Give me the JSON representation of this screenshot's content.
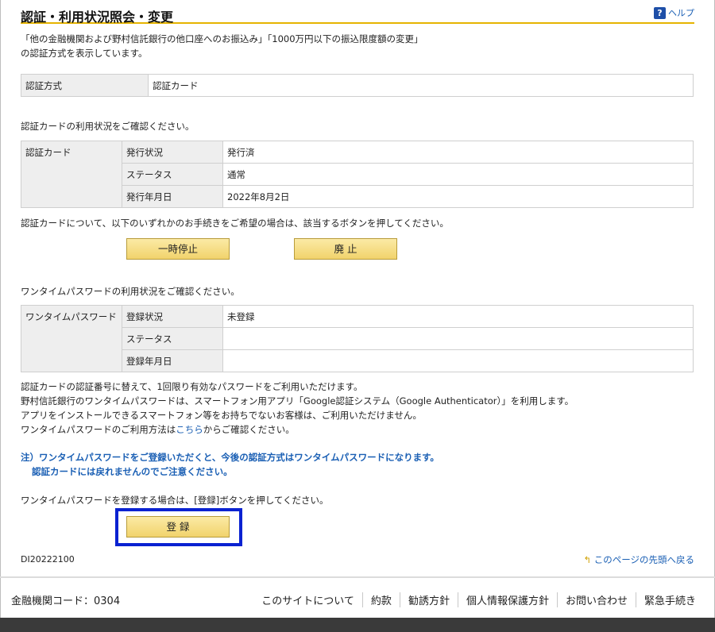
{
  "page": {
    "title": "認証・利用状況照会・変更",
    "help_label": "ヘルプ",
    "help_icon": "question-icon",
    "intro_line1": "「他の金融機関および野村信託銀行の他口座へのお振込み」「1000万円以下の振込限度額の変更」",
    "intro_line2": "の認証方式を表示しています。"
  },
  "auth_method": {
    "label": "認証方式",
    "value": "認証カード"
  },
  "card": {
    "intro": "認証カードの利用状況をご確認ください。",
    "header": "認証カード",
    "rows": [
      {
        "label": "発行状況",
        "value": "発行済"
      },
      {
        "label": "ステータス",
        "value": "通常"
      },
      {
        "label": "発行年月日",
        "value": "2022年8月2日"
      }
    ],
    "instruction": "認証カードについて、以下のいずれかのお手続きをご希望の場合は、該当するボタンを押してください。",
    "suspend_label": "一時停止",
    "abolish_label": "廃 止"
  },
  "otp": {
    "intro": "ワンタイムパスワードの利用状況をご確認ください。",
    "header": "ワンタイムパスワード",
    "rows": [
      {
        "label": "登録状況",
        "value": "未登録"
      },
      {
        "label": "ステータス",
        "value": ""
      },
      {
        "label": "登録年月日",
        "value": ""
      }
    ],
    "desc1": "認証カードの認証番号に替えて、1回限り有効なパスワードをご利用いただけます。",
    "desc2": "野村信託銀行のワンタイムパスワードは、スマートフォン用アプリ「Google認証システム（Google Authenticator）」を利用します。",
    "desc3": "アプリをインストールできるスマートフォン等をお持ちでないお客様は、ご利用いただけません。",
    "desc4_pre": "ワンタイムパスワードのご利用方法は",
    "desc4_link": "こちら",
    "desc4_post": "からご確認ください。",
    "note1": "注）ワンタイムパスワードをご登録いただくと、今後の認証方式はワンタイムパスワードになります。",
    "note2": "認証カードには戻れませんのでご注意ください。",
    "register_instruction": "ワンタイムパスワードを登録する場合は、[登録]ボタンを押してください。",
    "register_label": "登 録"
  },
  "screen_id": "DI20222100",
  "back_to_top": "このページの先頭へ戻る",
  "footer": {
    "bank_code": "金融機関コード：0304",
    "links": [
      "このサイトについて",
      "約款",
      "勧誘方針",
      "個人情報保護方針",
      "お問い合わせ",
      "緊急手続き"
    ]
  },
  "colors": {
    "accent": "#e5b400",
    "link": "#1a5fb4",
    "highlight_border": "#0a22d1"
  }
}
